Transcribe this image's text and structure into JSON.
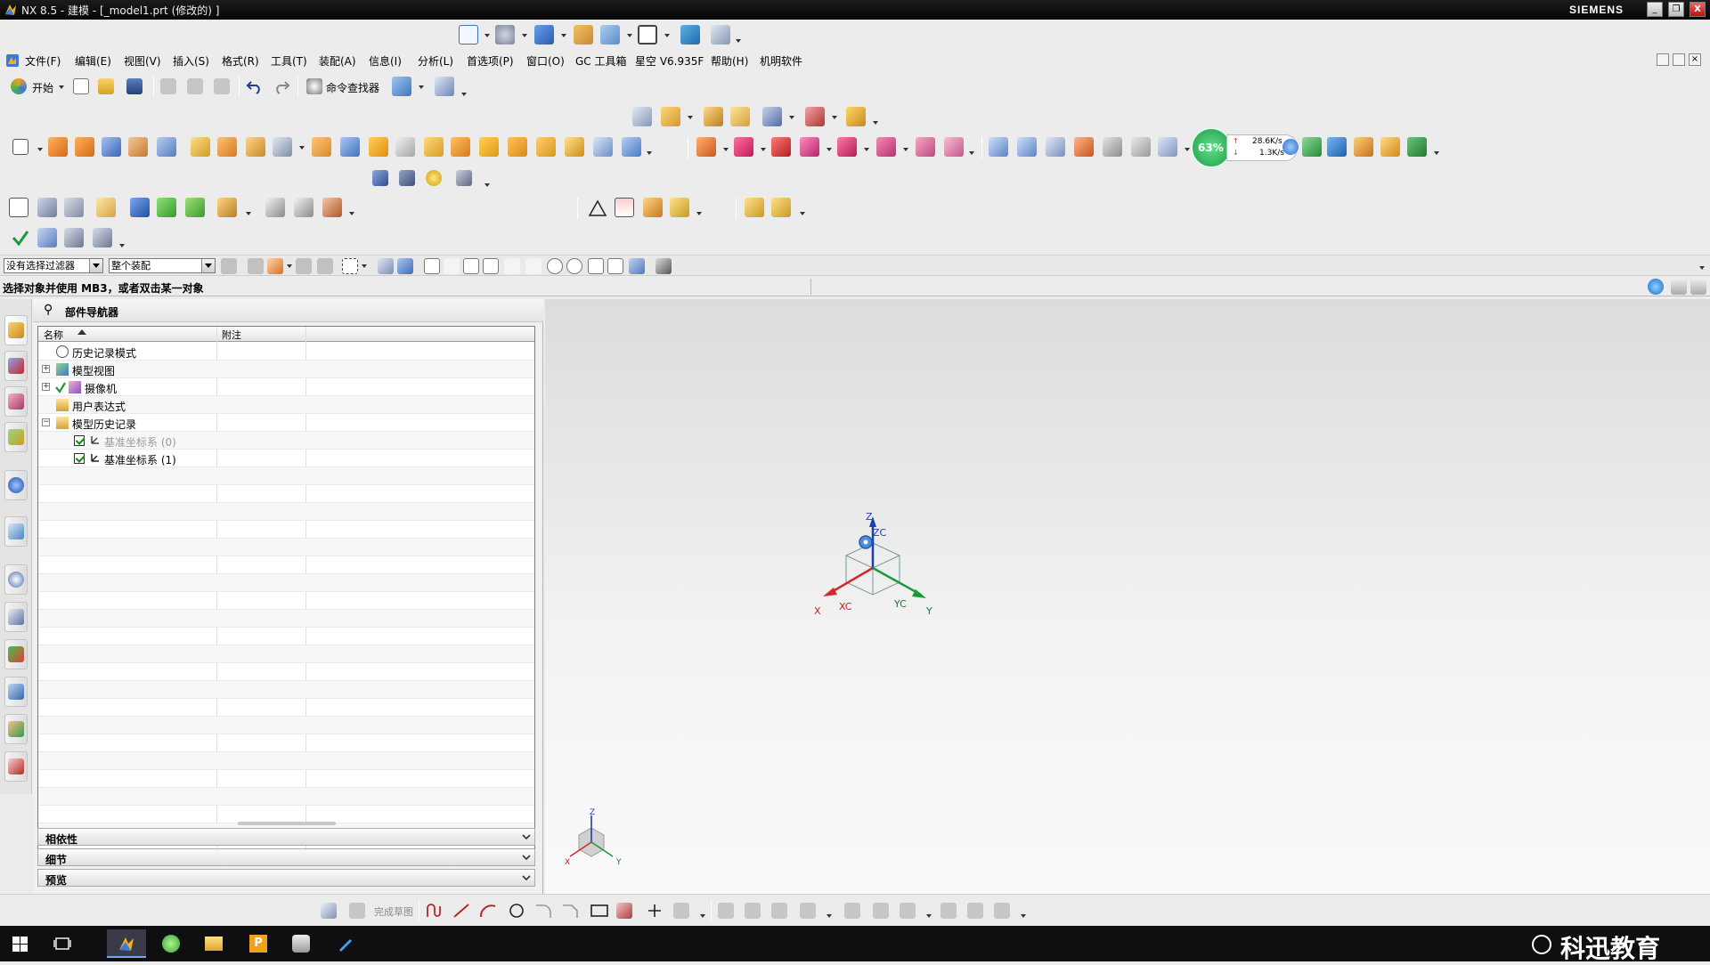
{
  "window": {
    "title": "NX 8.5 - 建模 - [_model1.prt (修改的) ]",
    "brand": "SIEMENS",
    "min": "_",
    "max": "❐",
    "close": "X"
  },
  "menu": {
    "items": [
      "文件(F)",
      "编辑(E)",
      "视图(V)",
      "插入(S)",
      "格式(R)",
      "工具(T)",
      "装配(A)",
      "信息(I)",
      "分析(L)",
      "首选项(P)",
      "窗口(O)",
      "GC 工具箱",
      "星空 V6.935F",
      "帮助(H)",
      "机明软件"
    ]
  },
  "standard_toolbar": {
    "start_label": "开始",
    "command_finder_label": "命令查找器"
  },
  "speed_widget": {
    "percent": "63%",
    "upload": "28.6K/s",
    "download": "1.3K/s"
  },
  "selection_bar": {
    "filter_value": "没有选择过滤器",
    "scope_value": "整个装配"
  },
  "status": {
    "message": "选择对象并使用 MB3，或者双击某一对象"
  },
  "navigator": {
    "title": "部件导航器",
    "col_name": "名称",
    "col_note": "附注",
    "rows": [
      {
        "label": "历史记录模式"
      },
      {
        "label": "模型视图"
      },
      {
        "label": "摄像机"
      },
      {
        "label": "用户表达式"
      },
      {
        "label": "模型历史记录"
      },
      {
        "label": "基准坐标系 (0)"
      },
      {
        "label": "基准坐标系 (1)"
      }
    ],
    "sections": [
      "相依性",
      "细节",
      "预览"
    ]
  },
  "viewport": {
    "csys_labels": {
      "z": "Z",
      "zc": "ZC",
      "x": "X",
      "xc": "XC",
      "y": "Y",
      "yc": "YC"
    },
    "triad_labels": {
      "z": "Z",
      "x": "X",
      "y": "Y"
    }
  },
  "sketch_toolbar": {
    "finish_sketch_label": "完成草图"
  },
  "watermark": "科迅教育",
  "colors": {
    "title_bg": "#0d0d0d",
    "taskbar_bg": "#0f0f12",
    "speed_green": "#2fb65a",
    "axis_x": "#d22a2a",
    "axis_y": "#1a9a3a",
    "axis_z": "#1a3fb0"
  }
}
